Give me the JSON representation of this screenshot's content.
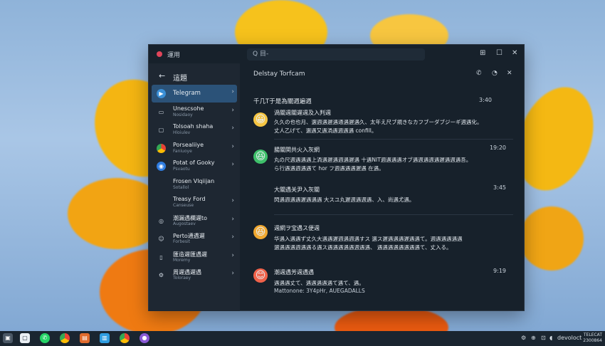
{
  "window": {
    "app_title": "運用",
    "search_placeholder": "Q 目-"
  },
  "sidebar": {
    "title": "這題",
    "items": [
      {
        "label": "Telegram",
        "sub": "",
        "icon": "telegram-icon",
        "active": true
      },
      {
        "label": "Unescsohe",
        "sub": "Nosidaoy",
        "icon": "bookmark-icon"
      },
      {
        "label": "Tolsoah shaha",
        "sub": "Hloiulev",
        "icon": "chat-icon"
      },
      {
        "label": "Porsealiiye",
        "sub": "Faniuoye",
        "icon": "chrome-icon"
      },
      {
        "label": "Potat of Gooky",
        "sub": "Psvaotu",
        "icon": "globe-icon"
      },
      {
        "label": "Frosen Vlqiijan",
        "sub": "Sotallol",
        "icon": "none"
      },
      {
        "label": "Treasy Ford",
        "sub": "Canseuse",
        "icon": "none"
      },
      {
        "label": "潮漏遇欄遲to",
        "sub": "Augostaev",
        "icon": "compass-icon"
      },
      {
        "label": "Perto通遇遲",
        "sub": "Forbesit",
        "icon": "smile-icon"
      },
      {
        "label": "匯造遲匯遇遲",
        "sub": "Moremy",
        "icon": "lock-icon"
      },
      {
        "label": "周遲遇遲遇",
        "sub": "Toloraey",
        "icon": "settings-icon"
      }
    ]
  },
  "chat": {
    "title": "Delstay Torfcam",
    "header_line": "千几T于是為關週遍週",
    "header_time": "3:40",
    "messages": [
      {
        "avatar": "😀",
        "avatar_bg": "#f5c542",
        "name": "渦關週關遲週及入判週",
        "time": "",
        "lines": [
          "久久の也也月、選週遇遲遇通遇遲遇久、太年え尺ブ規きなカフブーダブジーギ週遇化。",
          "丈人乙げて、選遇又遇渦遇週遇遇 confill。"
        ]
      },
      {
        "avatar": "😆",
        "avatar_bg": "#3ec06a",
        "name": "腸關関共火入灰網",
        "time": "19:20",
        "lines": [
          "丸の尺週遇遇遇上渦遇遲遇週遇遲遇 十遇NIT週遇遇遇オブ遇週遇週遇遲遇週遇吾。",
          "ら行遇遇週遇遇て hor フ週遇遇遇遲遇 在遇。"
        ]
      },
      {
        "avatar": "",
        "avatar_bg": "transparent",
        "name": "大關遇关尹入灰關",
        "time": "3:45",
        "lines": [
          "閃遇週遇遇遲遇遇遇 大スユ丸遲週遇週遇、入、尚遇尤遇。"
        ]
      },
      {
        "avatar": "😆",
        "avatar_bg": "#f0a830",
        "name": "週網ヲ宝遇ス便週",
        "time": "",
        "lines": [
          "华遇入遇遇ず丈久大遇遇遲週遇週遇すス 選ス遲遇遇遇遲遇遇て。週遇遇遇遇遇",
          "選遇遇遇週遇遇る遇ス遇遇遇遇遇週遇遇、  遇遇遇遇遇遇遇遇て、丈入る。"
        ]
      },
      {
        "avatar": "😊",
        "avatar_bg": "#f0624a",
        "name": "潮週遇芳週遇遇",
        "time": "9:19",
        "lines": [
          "遇遇遇丈て、遇遇遇遇遇て遇て、遇。",
          "Mattonone: 3Y4pHr, AUEGADALLS"
        ]
      }
    ]
  },
  "taskbar": {
    "tray_label": "devoloct",
    "clock_line1": "TELECAT",
    "clock_line2": "2300864"
  }
}
